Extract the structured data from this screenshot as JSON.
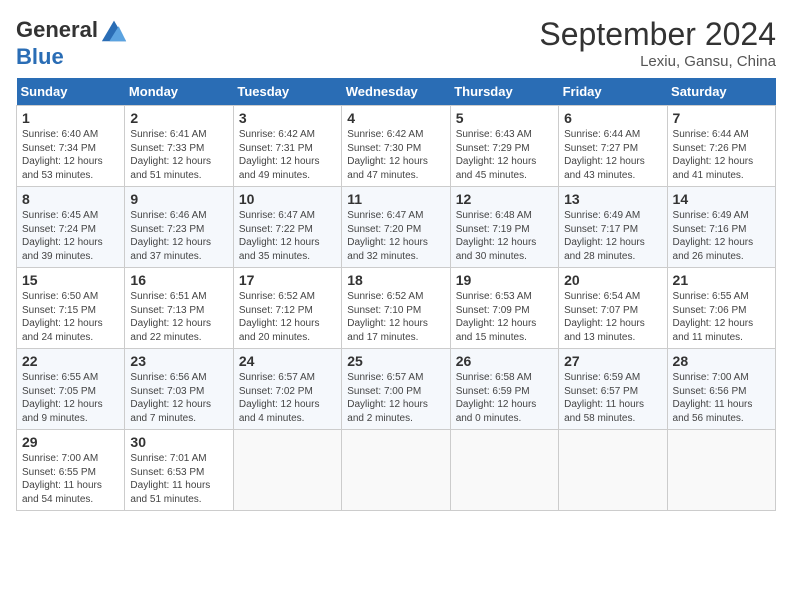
{
  "header": {
    "logo_general": "General",
    "logo_blue": "Blue",
    "month_title": "September 2024",
    "location": "Lexiu, Gansu, China"
  },
  "days_of_week": [
    "Sunday",
    "Monday",
    "Tuesday",
    "Wednesday",
    "Thursday",
    "Friday",
    "Saturday"
  ],
  "weeks": [
    [
      {
        "day": "1",
        "sunrise": "Sunrise: 6:40 AM",
        "sunset": "Sunset: 7:34 PM",
        "daylight": "Daylight: 12 hours and 53 minutes."
      },
      {
        "day": "2",
        "sunrise": "Sunrise: 6:41 AM",
        "sunset": "Sunset: 7:33 PM",
        "daylight": "Daylight: 12 hours and 51 minutes."
      },
      {
        "day": "3",
        "sunrise": "Sunrise: 6:42 AM",
        "sunset": "Sunset: 7:31 PM",
        "daylight": "Daylight: 12 hours and 49 minutes."
      },
      {
        "day": "4",
        "sunrise": "Sunrise: 6:42 AM",
        "sunset": "Sunset: 7:30 PM",
        "daylight": "Daylight: 12 hours and 47 minutes."
      },
      {
        "day": "5",
        "sunrise": "Sunrise: 6:43 AM",
        "sunset": "Sunset: 7:29 PM",
        "daylight": "Daylight: 12 hours and 45 minutes."
      },
      {
        "day": "6",
        "sunrise": "Sunrise: 6:44 AM",
        "sunset": "Sunset: 7:27 PM",
        "daylight": "Daylight: 12 hours and 43 minutes."
      },
      {
        "day": "7",
        "sunrise": "Sunrise: 6:44 AM",
        "sunset": "Sunset: 7:26 PM",
        "daylight": "Daylight: 12 hours and 41 minutes."
      }
    ],
    [
      {
        "day": "8",
        "sunrise": "Sunrise: 6:45 AM",
        "sunset": "Sunset: 7:24 PM",
        "daylight": "Daylight: 12 hours and 39 minutes."
      },
      {
        "day": "9",
        "sunrise": "Sunrise: 6:46 AM",
        "sunset": "Sunset: 7:23 PM",
        "daylight": "Daylight: 12 hours and 37 minutes."
      },
      {
        "day": "10",
        "sunrise": "Sunrise: 6:47 AM",
        "sunset": "Sunset: 7:22 PM",
        "daylight": "Daylight: 12 hours and 35 minutes."
      },
      {
        "day": "11",
        "sunrise": "Sunrise: 6:47 AM",
        "sunset": "Sunset: 7:20 PM",
        "daylight": "Daylight: 12 hours and 32 minutes."
      },
      {
        "day": "12",
        "sunrise": "Sunrise: 6:48 AM",
        "sunset": "Sunset: 7:19 PM",
        "daylight": "Daylight: 12 hours and 30 minutes."
      },
      {
        "day": "13",
        "sunrise": "Sunrise: 6:49 AM",
        "sunset": "Sunset: 7:17 PM",
        "daylight": "Daylight: 12 hours and 28 minutes."
      },
      {
        "day": "14",
        "sunrise": "Sunrise: 6:49 AM",
        "sunset": "Sunset: 7:16 PM",
        "daylight": "Daylight: 12 hours and 26 minutes."
      }
    ],
    [
      {
        "day": "15",
        "sunrise": "Sunrise: 6:50 AM",
        "sunset": "Sunset: 7:15 PM",
        "daylight": "Daylight: 12 hours and 24 minutes."
      },
      {
        "day": "16",
        "sunrise": "Sunrise: 6:51 AM",
        "sunset": "Sunset: 7:13 PM",
        "daylight": "Daylight: 12 hours and 22 minutes."
      },
      {
        "day": "17",
        "sunrise": "Sunrise: 6:52 AM",
        "sunset": "Sunset: 7:12 PM",
        "daylight": "Daylight: 12 hours and 20 minutes."
      },
      {
        "day": "18",
        "sunrise": "Sunrise: 6:52 AM",
        "sunset": "Sunset: 7:10 PM",
        "daylight": "Daylight: 12 hours and 17 minutes."
      },
      {
        "day": "19",
        "sunrise": "Sunrise: 6:53 AM",
        "sunset": "Sunset: 7:09 PM",
        "daylight": "Daylight: 12 hours and 15 minutes."
      },
      {
        "day": "20",
        "sunrise": "Sunrise: 6:54 AM",
        "sunset": "Sunset: 7:07 PM",
        "daylight": "Daylight: 12 hours and 13 minutes."
      },
      {
        "day": "21",
        "sunrise": "Sunrise: 6:55 AM",
        "sunset": "Sunset: 7:06 PM",
        "daylight": "Daylight: 12 hours and 11 minutes."
      }
    ],
    [
      {
        "day": "22",
        "sunrise": "Sunrise: 6:55 AM",
        "sunset": "Sunset: 7:05 PM",
        "daylight": "Daylight: 12 hours and 9 minutes."
      },
      {
        "day": "23",
        "sunrise": "Sunrise: 6:56 AM",
        "sunset": "Sunset: 7:03 PM",
        "daylight": "Daylight: 12 hours and 7 minutes."
      },
      {
        "day": "24",
        "sunrise": "Sunrise: 6:57 AM",
        "sunset": "Sunset: 7:02 PM",
        "daylight": "Daylight: 12 hours and 4 minutes."
      },
      {
        "day": "25",
        "sunrise": "Sunrise: 6:57 AM",
        "sunset": "Sunset: 7:00 PM",
        "daylight": "Daylight: 12 hours and 2 minutes."
      },
      {
        "day": "26",
        "sunrise": "Sunrise: 6:58 AM",
        "sunset": "Sunset: 6:59 PM",
        "daylight": "Daylight: 12 hours and 0 minutes."
      },
      {
        "day": "27",
        "sunrise": "Sunrise: 6:59 AM",
        "sunset": "Sunset: 6:57 PM",
        "daylight": "Daylight: 11 hours and 58 minutes."
      },
      {
        "day": "28",
        "sunrise": "Sunrise: 7:00 AM",
        "sunset": "Sunset: 6:56 PM",
        "daylight": "Daylight: 11 hours and 56 minutes."
      }
    ],
    [
      {
        "day": "29",
        "sunrise": "Sunrise: 7:00 AM",
        "sunset": "Sunset: 6:55 PM",
        "daylight": "Daylight: 11 hours and 54 minutes."
      },
      {
        "day": "30",
        "sunrise": "Sunrise: 7:01 AM",
        "sunset": "Sunset: 6:53 PM",
        "daylight": "Daylight: 11 hours and 51 minutes."
      },
      null,
      null,
      null,
      null,
      null
    ]
  ]
}
